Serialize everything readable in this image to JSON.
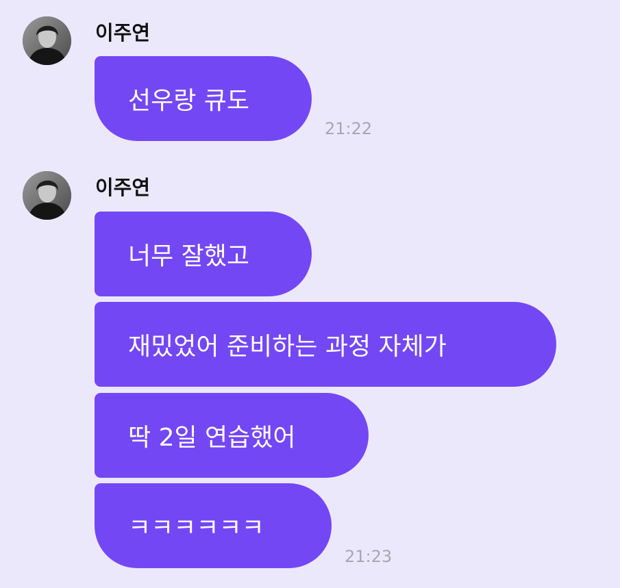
{
  "groups": [
    {
      "sender": "이주연",
      "messages": [
        "선우랑 큐도"
      ],
      "time": "21:22"
    },
    {
      "sender": "이주연",
      "messages": [
        "너무 잘했고",
        "재밌었어 준비하는 과정 자체가",
        "딱 2일 연습했어",
        "ㅋㅋㅋㅋㅋㅋ"
      ],
      "time": "21:23"
    }
  ],
  "colors": {
    "background": "#ECE8FB",
    "bubble": "#7447F5",
    "bubble_text": "#FFFFFF",
    "time_text": "#A8A6B2"
  }
}
